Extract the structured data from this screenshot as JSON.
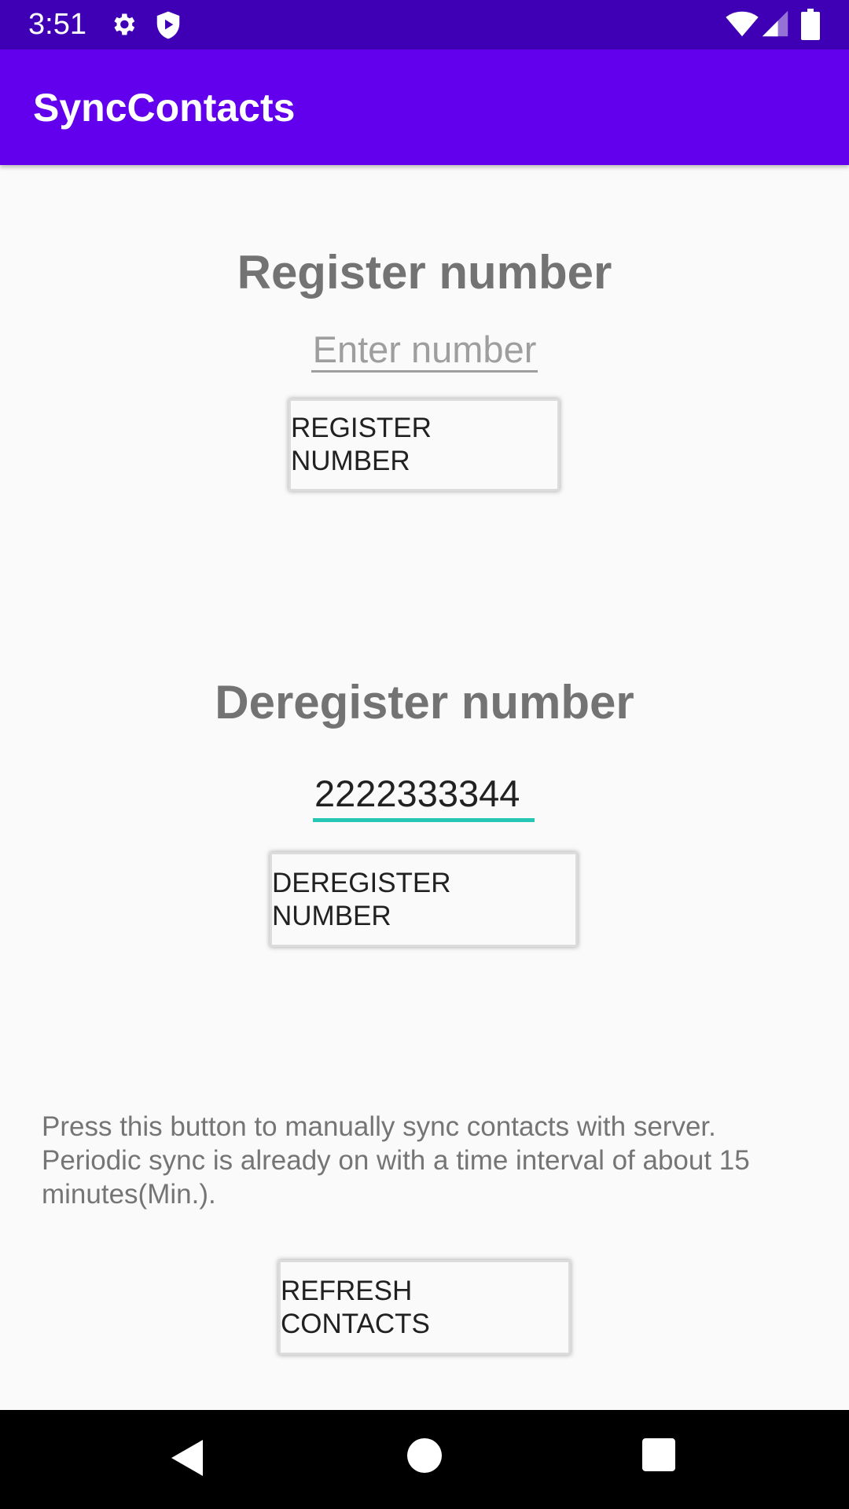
{
  "status_bar": {
    "time": "3:51",
    "icons": [
      "gear-icon",
      "shield-play-icon",
      "wifi-icon",
      "signal-icon",
      "battery-icon"
    ]
  },
  "app_bar": {
    "title": "SyncContacts"
  },
  "register": {
    "heading": "Register number",
    "placeholder": "Enter number",
    "button_label": "REGISTER NUMBER"
  },
  "deregister": {
    "heading": "Deregister number",
    "value": "2222333344",
    "button_label": "DEREGISTER NUMBER"
  },
  "refresh": {
    "info": "Press this button to manually sync contacts with server. Periodic sync is already on with a time interval of about 15 minutes(Min.).",
    "button_label": "REFRESH CONTACTS"
  },
  "nav_bar": {
    "buttons": [
      "back-icon",
      "home-icon",
      "recents-icon"
    ]
  },
  "colors": {
    "status_bar": "#3f00b5",
    "app_bar": "#6200ee",
    "accent": "#26c6b4"
  }
}
